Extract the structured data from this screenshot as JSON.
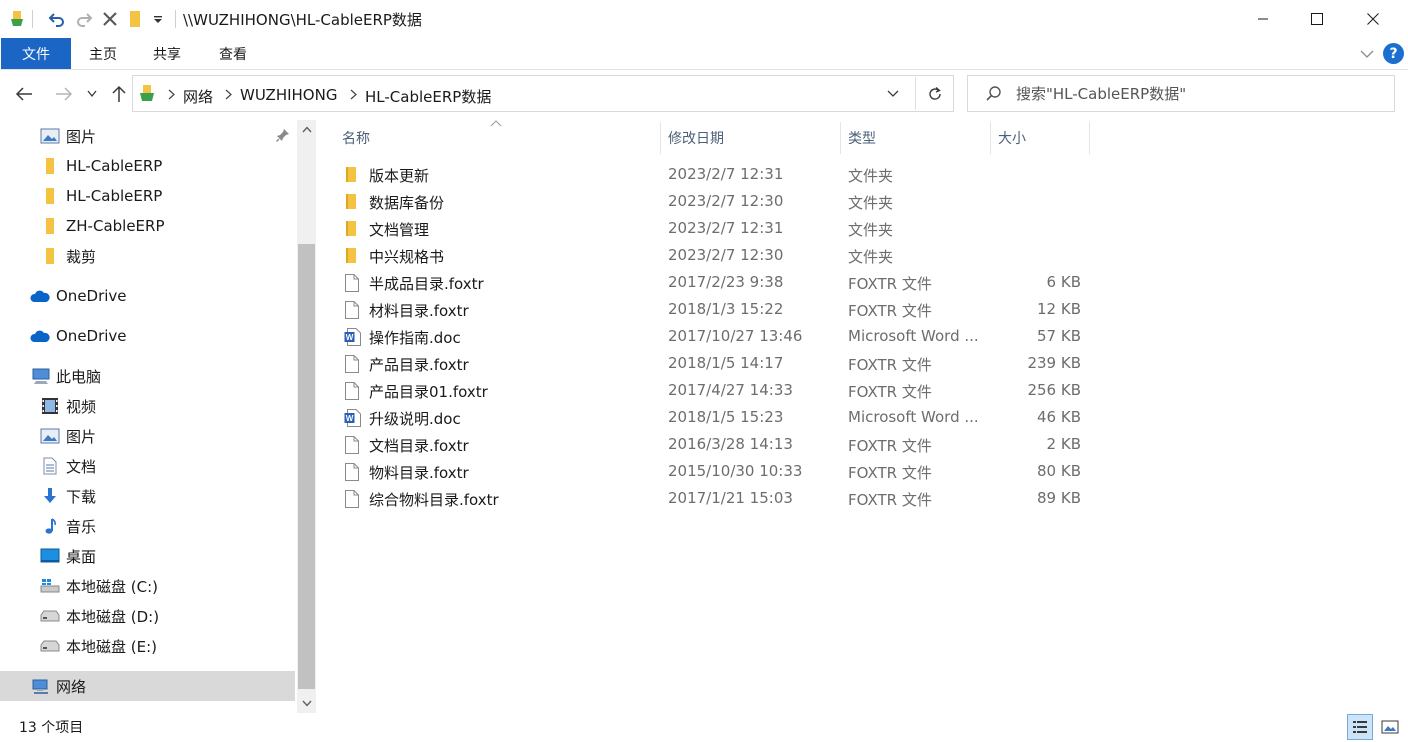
{
  "window": {
    "title": "\\\\WUZHIHONG\\HL-CableERP数据"
  },
  "ribbon": {
    "tabs": [
      {
        "label": "文件",
        "active": true
      },
      {
        "label": "主页",
        "active": false
      },
      {
        "label": "共享",
        "active": false
      },
      {
        "label": "查看",
        "active": false
      }
    ],
    "help_label": "?"
  },
  "address": {
    "crumbs": [
      "网络",
      "WUZHIHONG",
      "HL-CableERP数据"
    ]
  },
  "search": {
    "placeholder": "搜索\"HL-CableERP数据\""
  },
  "nav": {
    "items": [
      {
        "label": "图片",
        "icon": "pictures-icon",
        "pinned": true
      },
      {
        "label": "HL-CableERP",
        "icon": "folder-icon"
      },
      {
        "label": "HL-CableERP",
        "icon": "folder-icon"
      },
      {
        "label": "ZH-CableERP",
        "icon": "folder-icon"
      },
      {
        "label": "裁剪",
        "icon": "folder-icon"
      },
      {
        "label": "OneDrive",
        "icon": "onedrive-icon"
      },
      {
        "label": "OneDrive",
        "icon": "onedrive-icon"
      },
      {
        "label": "此电脑",
        "icon": "this-pc-icon"
      },
      {
        "label": "视频",
        "icon": "videos-icon"
      },
      {
        "label": "图片",
        "icon": "pictures-icon"
      },
      {
        "label": "文档",
        "icon": "documents-icon"
      },
      {
        "label": "下载",
        "icon": "downloads-icon"
      },
      {
        "label": "音乐",
        "icon": "music-icon"
      },
      {
        "label": "桌面",
        "icon": "desktop-icon"
      },
      {
        "label": "本地磁盘 (C:)",
        "icon": "windows-drive-icon"
      },
      {
        "label": "本地磁盘 (D:)",
        "icon": "drive-icon"
      },
      {
        "label": "本地磁盘 (E:)",
        "icon": "drive-icon"
      },
      {
        "label": "网络",
        "icon": "network-icon",
        "selected": true
      }
    ]
  },
  "columns": {
    "name": "名称",
    "date": "修改日期",
    "type": "类型",
    "size": "大小"
  },
  "files": [
    {
      "name": "版本更新",
      "date": "2023/2/7 12:31",
      "type": "文件夹",
      "size": "",
      "icon": "folder-icon"
    },
    {
      "name": "数据库备份",
      "date": "2023/2/7 12:30",
      "type": "文件夹",
      "size": "",
      "icon": "folder-icon"
    },
    {
      "name": "文档管理",
      "date": "2023/2/7 12:31",
      "type": "文件夹",
      "size": "",
      "icon": "folder-icon"
    },
    {
      "name": "中兴规格书",
      "date": "2023/2/7 12:30",
      "type": "文件夹",
      "size": "",
      "icon": "folder-icon"
    },
    {
      "name": "半成品目录.foxtr",
      "date": "2017/2/23 9:38",
      "type": "FOXTR 文件",
      "size": "6 KB",
      "icon": "file-icon"
    },
    {
      "name": "材料目录.foxtr",
      "date": "2018/1/3 15:22",
      "type": "FOXTR 文件",
      "size": "12 KB",
      "icon": "file-icon"
    },
    {
      "name": "操作指南.doc",
      "date": "2017/10/27 13:46",
      "type": "Microsoft Word ...",
      "size": "57 KB",
      "icon": "word-doc-icon"
    },
    {
      "name": "产品目录.foxtr",
      "date": "2018/1/5 14:17",
      "type": "FOXTR 文件",
      "size": "239 KB",
      "icon": "file-icon"
    },
    {
      "name": "产品目录01.foxtr",
      "date": "2017/4/27 14:33",
      "type": "FOXTR 文件",
      "size": "256 KB",
      "icon": "file-icon"
    },
    {
      "name": "升级说明.doc",
      "date": "2018/1/5 15:23",
      "type": "Microsoft Word ...",
      "size": "46 KB",
      "icon": "word-doc-icon"
    },
    {
      "name": "文档目录.foxtr",
      "date": "2016/3/28 14:13",
      "type": "FOXTR 文件",
      "size": "2 KB",
      "icon": "file-icon"
    },
    {
      "name": "物料目录.foxtr",
      "date": "2015/10/30 10:33",
      "type": "FOXTR 文件",
      "size": "80 KB",
      "icon": "file-icon"
    },
    {
      "name": "综合物料目录.foxtr",
      "date": "2017/1/21 15:03",
      "type": "FOXTR 文件",
      "size": "89 KB",
      "icon": "file-icon"
    }
  ],
  "status": {
    "item_count": "13 个项目"
  },
  "colors": {
    "accent": "#1b66c4",
    "folder": "#f5c342",
    "selected_nav": "#d9d9d9"
  }
}
